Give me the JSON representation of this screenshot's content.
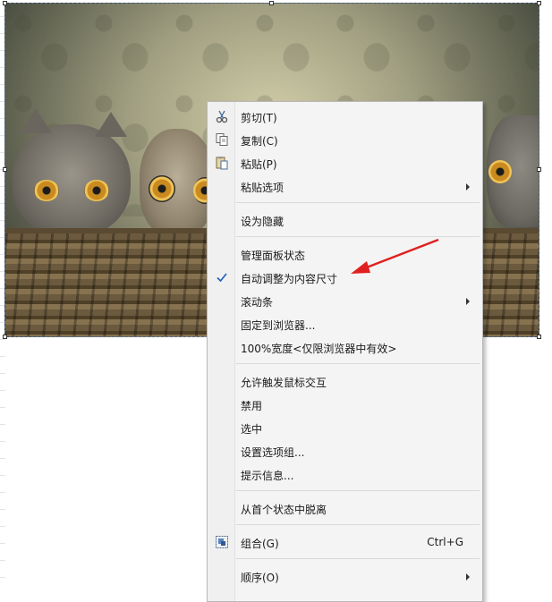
{
  "context_menu": {
    "items": [
      {
        "label": "剪切(T)",
        "icon": "scissors-icon"
      },
      {
        "label": "复制(C)",
        "icon": "copy-icon"
      },
      {
        "label": "粘贴(P)",
        "icon": "paste-icon"
      },
      {
        "label": "粘贴选项",
        "submenu": true
      },
      {
        "label": "设为隐藏"
      },
      {
        "label": "管理面板状态"
      },
      {
        "label": "自动调整为内容尺寸",
        "checked": true,
        "icon": "checkmark-icon"
      },
      {
        "label": "滚动条",
        "submenu": true
      },
      {
        "label": "固定到浏览器..."
      },
      {
        "label": "100%宽度<仅限浏览器中有效>"
      },
      {
        "label": "允许触发鼠标交互"
      },
      {
        "label": "禁用"
      },
      {
        "label": "选中"
      },
      {
        "label": "设置选项组..."
      },
      {
        "label": "提示信息..."
      },
      {
        "label": "从首个状态中脱离"
      },
      {
        "label": "组合(G)",
        "shortcut": "Ctrl+G",
        "icon": "group-icon"
      },
      {
        "label": "顺序(O)",
        "submenu": true
      }
    ]
  },
  "annotation": {
    "arrow_color": "#e02020"
  },
  "colors": {
    "menu_bg": "#f4f4f4",
    "check": "#1f5fbf"
  }
}
